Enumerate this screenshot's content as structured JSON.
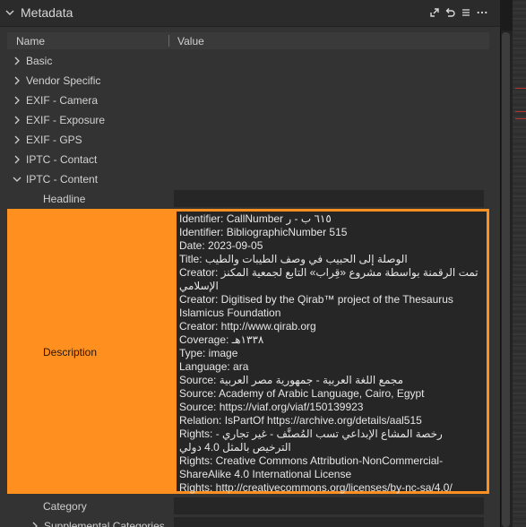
{
  "panel": {
    "title": "Metadata",
    "icons": [
      "expand-icon",
      "undo-icon",
      "menu-icon",
      "more-icon"
    ]
  },
  "columns": {
    "name": "Name",
    "value": "Value"
  },
  "groups": [
    {
      "label": "Basic",
      "expanded": false
    },
    {
      "label": "Vendor Specific",
      "expanded": false
    },
    {
      "label": "EXIF - Camera",
      "expanded": false
    },
    {
      "label": "EXIF - Exposure",
      "expanded": false
    },
    {
      "label": "EXIF - GPS",
      "expanded": false
    },
    {
      "label": "IPTC - Contact",
      "expanded": false
    },
    {
      "label": "IPTC - Content",
      "expanded": true
    }
  ],
  "fields": {
    "headline": {
      "label": "Headline",
      "value": ""
    },
    "description": {
      "label": "Description",
      "lines": [
        "Identifier: CallNumber ٦١٥ ب - ر",
        "Identifier: BibliographicNumber 515",
        "Date: 2023-09-05",
        "Title: الوصلة إلى الحبيب في وصف الطيبات والطيب",
        "Creator: تمت الرقمنة بواسطة مشروع «قِراب» التابع لجمعية المكنز الإسلامي",
        "Creator: Digitised by the Qirab™ project of the Thesaurus Islamicus Foundation",
        "Creator: http://www.qirab.org",
        "Coverage: ١٣٣٨هـ",
        "Type: image",
        "Language: ara",
        "Source: مجمع اللغة العربية - جمهورية مصر العربية",
        "Source: Academy of Arabic Language, Cairo, Egypt",
        "Source: https://viaf.org/viaf/150139923",
        "Relation: IsPartOf https://archive.org/details/aal515",
        "Rights: رخصة المشاع الإبداعي تسب المُصنَّف - غير تجاري - الترخيص بالمثل 4.0 دولي",
        "Rights: Creative Commons Attribution-NonCommercial-ShareAlike 4.0 International License",
        "Rights: http://creativecommons.org/licenses/by-nc-sa/4.0/"
      ]
    },
    "category": {
      "label": "Category",
      "value": ""
    },
    "supplemental": {
      "label": "Supplemental Categories",
      "expanded": false
    }
  },
  "colors": {
    "highlight": "#ff8f1f",
    "background": "#333333",
    "value_bg": "#262626"
  }
}
